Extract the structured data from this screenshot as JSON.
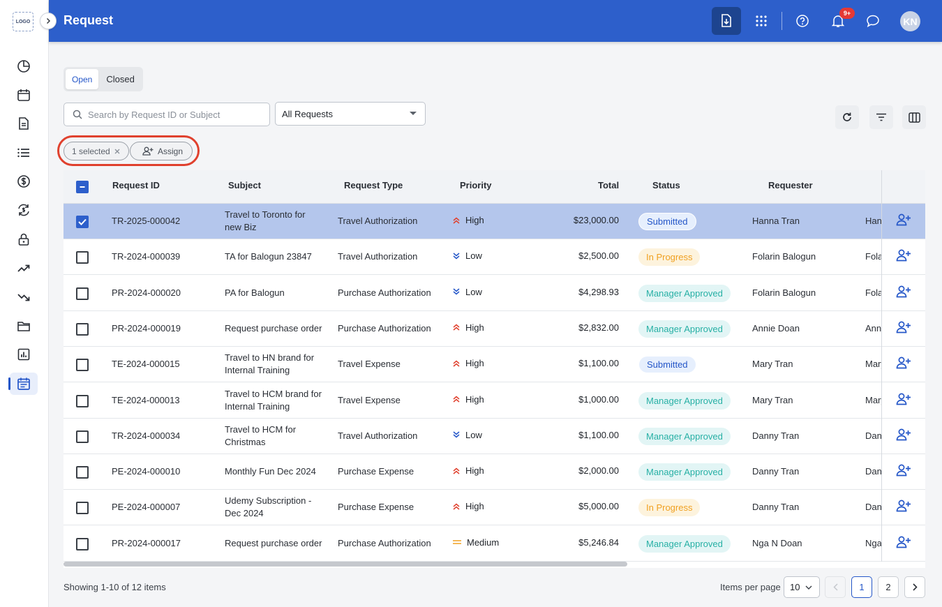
{
  "sidebar": {
    "logo_text": "LOGO",
    "items": [
      {
        "icon": "pie-chart-icon"
      },
      {
        "icon": "calendar-icon"
      },
      {
        "icon": "document-icon"
      },
      {
        "icon": "list-icon"
      },
      {
        "icon": "dollar-circle-icon"
      },
      {
        "icon": "currency-exchange-icon"
      },
      {
        "icon": "lock-icon"
      },
      {
        "icon": "trending-up-icon"
      },
      {
        "icon": "trending-down-icon"
      },
      {
        "icon": "folder-icon"
      },
      {
        "icon": "bar-report-icon"
      },
      {
        "icon": "request-calendar-icon",
        "active": true
      }
    ]
  },
  "header": {
    "title": "Request",
    "notification_count": "9+",
    "avatar_initials": "KN",
    "accent": "#2d5fcb"
  },
  "tabs": [
    {
      "label": "Open",
      "active": true
    },
    {
      "label": "Closed",
      "active": false
    }
  ],
  "filters": {
    "search_placeholder": "Search by Request ID or Subject",
    "dropdown_value": "All Requests"
  },
  "selection": {
    "chip_label": "1 selected",
    "assign_label": "Assign"
  },
  "table": {
    "headers": {
      "request_id": "Request ID",
      "subject": "Subject",
      "request_type": "Request Type",
      "priority": "Priority",
      "total": "Total",
      "status": "Status",
      "requester": "Requester"
    },
    "rows": [
      {
        "id": "TR-2025-000042",
        "subject": "Travel to Toronto for new Biz",
        "type": "Travel Authorization",
        "priority": "High",
        "total": "$23,000.00",
        "status": "Submitted",
        "requester": "Hanna Tran",
        "extra": "Han",
        "selected": true
      },
      {
        "id": "TR-2024-000039",
        "subject": "TA for Balogun 23847",
        "type": "Travel Authorization",
        "priority": "Low",
        "total": "$2,500.00",
        "status": "In Progress",
        "requester": "Folarin Balogun",
        "extra": "Fola",
        "selected": false
      },
      {
        "id": "PR-2024-000020",
        "subject": "PA for Balogun",
        "type": "Purchase Authorization",
        "priority": "Low",
        "total": "$4,298.93",
        "status": "Manager Approved",
        "requester": "Folarin Balogun",
        "extra": "Fola",
        "selected": false
      },
      {
        "id": "PR-2024-000019",
        "subject": "Request purchase order",
        "type": "Purchase Authorization",
        "priority": "High",
        "total": "$2,832.00",
        "status": "Manager Approved",
        "requester": "Annie Doan",
        "extra": "Anni",
        "selected": false
      },
      {
        "id": "TE-2024-000015",
        "subject": "Travel to HN brand for Internal Training",
        "type": "Travel Expense",
        "priority": "High",
        "total": "$1,100.00",
        "status": "Submitted",
        "requester": "Mary Tran",
        "extra": "Mary",
        "selected": false
      },
      {
        "id": "TE-2024-000013",
        "subject": "Travel to HCM brand for Internal Training",
        "type": "Travel Expense",
        "priority": "High",
        "total": "$1,000.00",
        "status": "Manager Approved",
        "requester": "Mary Tran",
        "extra": "Mary",
        "selected": false
      },
      {
        "id": "TR-2024-000034",
        "subject": "Travel to HCM for Christmas",
        "type": "Travel Authorization",
        "priority": "Low",
        "total": "$1,100.00",
        "status": "Manager Approved",
        "requester": "Danny Tran",
        "extra": "Dann",
        "selected": false
      },
      {
        "id": "PE-2024-000010",
        "subject": "Monthly Fun Dec 2024",
        "type": "Purchase Expense",
        "priority": "High",
        "total": "$2,000.00",
        "status": "Manager Approved",
        "requester": "Danny Tran",
        "extra": "Dann",
        "selected": false
      },
      {
        "id": "PE-2024-000007",
        "subject": "Udemy Subscription - Dec 2024",
        "type": "Purchase Expense",
        "priority": "High",
        "total": "$5,000.00",
        "status": "In Progress",
        "requester": "Danny Tran",
        "extra": "Dann",
        "selected": false
      },
      {
        "id": "PR-2024-000017",
        "subject": "Request purchase order",
        "type": "Purchase Authorization",
        "priority": "Medium",
        "total": "$5,246.84",
        "status": "Manager Approved",
        "requester": "Nga N Doan",
        "extra": "Nga",
        "selected": false
      }
    ]
  },
  "footer": {
    "showing": "Showing 1-10 of 12 items",
    "items_per_page_label": "Items per page",
    "items_per_page_value": "10",
    "pages": [
      "1",
      "2"
    ],
    "current_page": "1"
  },
  "colors": {
    "high": "#e0412e",
    "low": "#2456c8",
    "medium": "#f0a020"
  }
}
